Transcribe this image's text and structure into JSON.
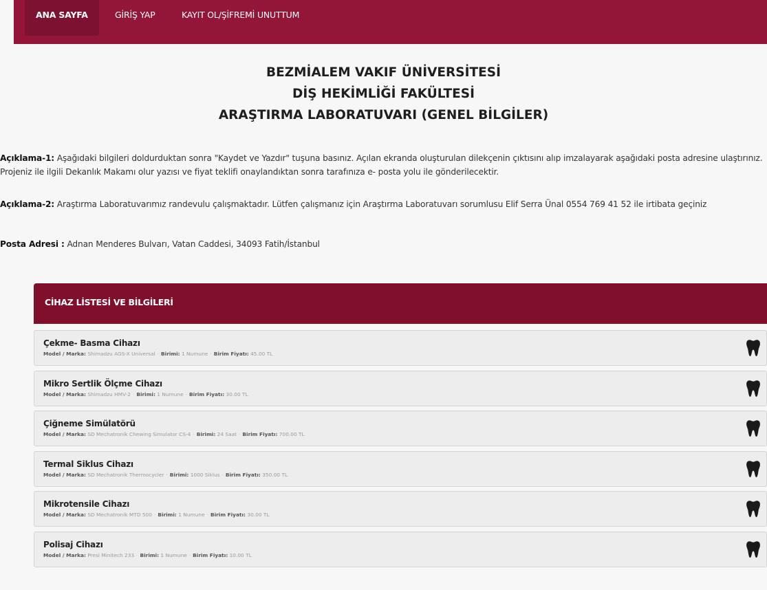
{
  "nav": {
    "home": "ANA SAYFA",
    "login": "GİRİŞ YAP",
    "register": "KAYIT OL/ŞİFREMİ UNUTTUM"
  },
  "heading": {
    "line1": "BEZMİALEM VAKIF ÜNİVERSİTESİ",
    "line2": "DİŞ HEKİMLİĞİ FAKÜLTESİ",
    "line3": "ARAŞTIRMA LABORATUVARI (GENEL BİLGİLER)"
  },
  "info": {
    "desc1_label": "Açıklama-1:",
    "desc1_text": " Aşağıdaki bilgileri doldurduktan sonra \"Kaydet ve Yazdır\" tuşuna basınız. Açılan ekranda oluşturulan dilekçenin çıktısını alıp imzalayarak aşağıdaki posta adresine ulaştırınız. Projeniz ile ilgili Dekanlık Makamı olur yazısı ve fiyat teklifi onaylandıktan sonra tarafınıza e- posta yolu ile gönderilecektir.",
    "desc2_label": "Açıklama-2:",
    "desc2_text": " Araştırma Laboratuvarımız randevulu çalışmaktadır. Lütfen çalışmanız için Araştırma Laboratuvarı sorumlusu Elif Serra Ünal 0554 769 41 52 ile irtibata geçiniz",
    "address_label": "Posta Adresi :",
    "address_text": " Adnan Menderes Bulvarı, Vatan Caddesi, 34093 Fatih/İstanbul"
  },
  "panel": {
    "title": "CİHAZ LİSTESİ VE BİLGİLERİ",
    "model_label": "Model / Marka:",
    "unit_label": "Birimi:",
    "price_label": "Birim Fiyatı:",
    "devices": [
      {
        "name": "Çekme- Basma Cihazı",
        "model": "Shimadzu AGS-X Universal",
        "unit": "1 Numune",
        "price": "45.00 TL"
      },
      {
        "name": "Mikro Sertlik Ölçme Cihazı",
        "model": "Shimadzu HMV-2",
        "unit": "1 Numune",
        "price": "30.00 TL"
      },
      {
        "name": "Çiğneme Simülatörü",
        "model": "SD Mechatronik Chewing Simulator CS-4",
        "unit": "24 Saat",
        "price": "700.00 TL"
      },
      {
        "name": "Termal Siklus Cihazı",
        "model": "SD Mechatronik Thermocycler",
        "unit": "1000 Siklus",
        "price": "350.00 TL"
      },
      {
        "name": "Mikrotensile Cihazı",
        "model": "SD Mechatronik MTD 500",
        "unit": "1 Numune",
        "price": "30.00 TL"
      },
      {
        "name": "Polisaj Cihazı",
        "model": "Presi Minitech 233",
        "unit": "1 Numune",
        "price": "10.00 TL"
      }
    ]
  },
  "icons": {
    "device_icon": "tooth-icon"
  },
  "colors": {
    "navbar": "#931538",
    "panel_header": "#7f0f2b"
  }
}
